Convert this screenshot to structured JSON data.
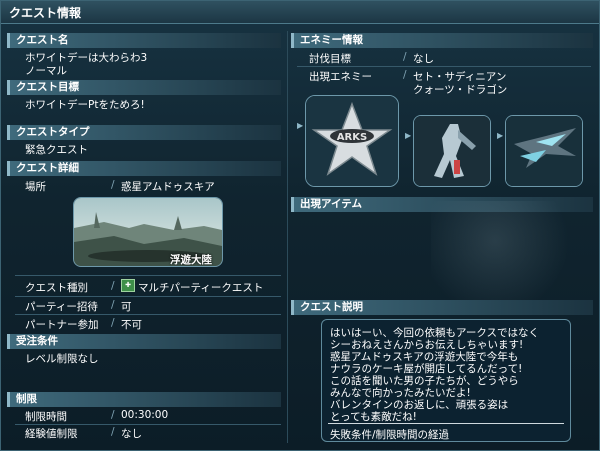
{
  "window_title": "クエスト情報",
  "left": {
    "quest_name": {
      "header": "クエスト名",
      "line1": "ホワイトデーは大わらわ3",
      "line2": "ノーマル"
    },
    "quest_goal": {
      "header": "クエスト目標",
      "text": "ホワイトデーPtをためろ!"
    },
    "quest_type": {
      "header": "クエストタイプ",
      "text": "緊急クエスト"
    },
    "quest_detail": {
      "header": "クエスト詳細",
      "location_label": "場所",
      "location_value": "惑星アムドゥスキア",
      "image_caption": "浮遊大陸",
      "kind_label": "クエスト種別",
      "kind_value": "マルチパーティークエスト",
      "kind_icon": "multi-party-icon",
      "party_label": "パーティー招待",
      "party_value": "可",
      "partner_label": "パートナー参加",
      "partner_value": "不可"
    },
    "conditions": {
      "header": "受注条件",
      "text": "レベル制限なし"
    },
    "limits": {
      "header": "制限",
      "time_label": "制限時間",
      "time_value": "00:30:00",
      "exp_label": "経験値制限",
      "exp_value": "なし"
    }
  },
  "right": {
    "enemy": {
      "header": "エネミー情報",
      "target_label": "討伐目標",
      "target_value": "なし",
      "appear_label": "出現エネミー",
      "appear_value1": "セト・サディニアン",
      "appear_value2": "クォーツ・ドラゴン",
      "emblem_text": "ARKS"
    },
    "items": {
      "header": "出現アイテム"
    },
    "desc": {
      "header": "クエスト説明",
      "lines": [
        "はいはーい、今回の依頼もアークスではなく",
        "シーおねえさんからお伝えしちゃいます!",
        "惑星アムドゥスキアの浮遊大陸で今年も",
        "ナウラのケーキ屋が開店してるんだって!",
        "この話を聞いた男の子たちが、どうやら",
        "みんなで向かったみたいだよ!",
        "バレンタインのお返しに、頑張る姿は",
        "とっても素敵だね!"
      ],
      "fail_condition": "失敗条件/制限時間の経過"
    }
  }
}
